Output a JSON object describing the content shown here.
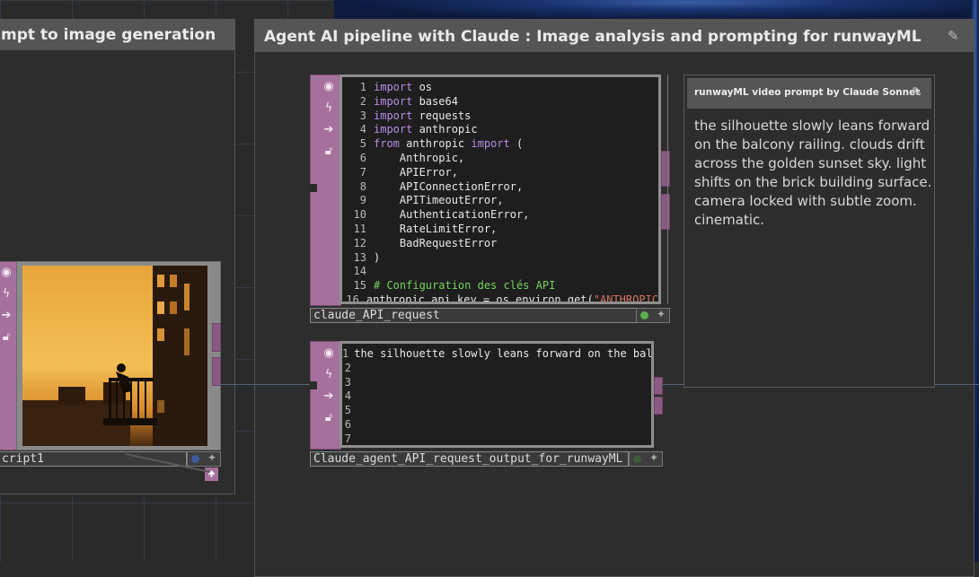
{
  "left_box": {
    "title": "mpt to image generation",
    "op_name": "cript1"
  },
  "main_box": {
    "title": "Agent AI pipeline with Claude : Image analysis and prompting for runwayML"
  },
  "code_op": {
    "name": "claude_API_request",
    "lines": [
      {
        "n": "1",
        "segs": [
          {
            "c": "kw",
            "t": "import"
          },
          {
            "c": "tx",
            "t": " os"
          }
        ]
      },
      {
        "n": "2",
        "segs": [
          {
            "c": "kw",
            "t": "import"
          },
          {
            "c": "tx",
            "t": " base64"
          }
        ]
      },
      {
        "n": "3",
        "segs": [
          {
            "c": "kw",
            "t": "import"
          },
          {
            "c": "tx",
            "t": " requests"
          }
        ]
      },
      {
        "n": "4",
        "segs": [
          {
            "c": "kw",
            "t": "import"
          },
          {
            "c": "tx",
            "t": " anthropic"
          }
        ]
      },
      {
        "n": "5",
        "segs": [
          {
            "c": "kw",
            "t": "from"
          },
          {
            "c": "tx",
            "t": " anthropic "
          },
          {
            "c": "kw",
            "t": "import"
          },
          {
            "c": "tx",
            "t": " ("
          }
        ]
      },
      {
        "n": "6",
        "segs": [
          {
            "c": "tx",
            "t": "    Anthropic,"
          }
        ]
      },
      {
        "n": "7",
        "segs": [
          {
            "c": "tx",
            "t": "    APIError,"
          }
        ]
      },
      {
        "n": "8",
        "segs": [
          {
            "c": "tx",
            "t": "    APIConnectionError,"
          }
        ]
      },
      {
        "n": "9",
        "segs": [
          {
            "c": "tx",
            "t": "    APITimeoutError,"
          }
        ]
      },
      {
        "n": "10",
        "segs": [
          {
            "c": "tx",
            "t": "    AuthenticationError,"
          }
        ]
      },
      {
        "n": "11",
        "segs": [
          {
            "c": "tx",
            "t": "    RateLimitError,"
          }
        ]
      },
      {
        "n": "12",
        "segs": [
          {
            "c": "tx",
            "t": "    BadRequestError"
          }
        ]
      },
      {
        "n": "13",
        "segs": [
          {
            "c": "tx",
            "t": ")"
          }
        ]
      },
      {
        "n": "14",
        "segs": []
      },
      {
        "n": "15",
        "segs": [
          {
            "c": "cm",
            "t": "# Configuration des clés API"
          }
        ]
      },
      {
        "n": "16",
        "segs": [
          {
            "c": "tx",
            "t": "anthropic_api_key = os.environ.get("
          },
          {
            "c": "st",
            "t": "\"ANTHROPIC"
          }
        ]
      }
    ]
  },
  "output_op": {
    "name": "Claude_agent_API_request_output_for_runwayML",
    "lines": [
      {
        "n": "1",
        "t": "the silhouette slowly leans forward on the balcony railing."
      },
      {
        "n": "2",
        "t": ""
      },
      {
        "n": "3",
        "t": ""
      },
      {
        "n": "4",
        "t": ""
      },
      {
        "n": "5",
        "t": ""
      },
      {
        "n": "6",
        "t": ""
      },
      {
        "n": "7",
        "t": ""
      }
    ]
  },
  "prompt_panel": {
    "title": "runwayML video prompt by Claude Sonnet",
    "text": "the silhouette slowly leans forward on the balcony railing. clouds drift across the golden sunset sky. light shifts on the brick building surface. camera locked with subtle zoom. cinematic."
  },
  "icons": {
    "viewer": "eye-icon",
    "bypass": "lightning-icon",
    "display": "arrow-right-icon",
    "lock": "lock-icon",
    "edit": "edit-icon"
  },
  "colors": {
    "accent_pink": "#a6709d",
    "active_green": "#5ab04a",
    "comment_green": "#76d35f",
    "keyword_purple": "#b98fe8"
  }
}
